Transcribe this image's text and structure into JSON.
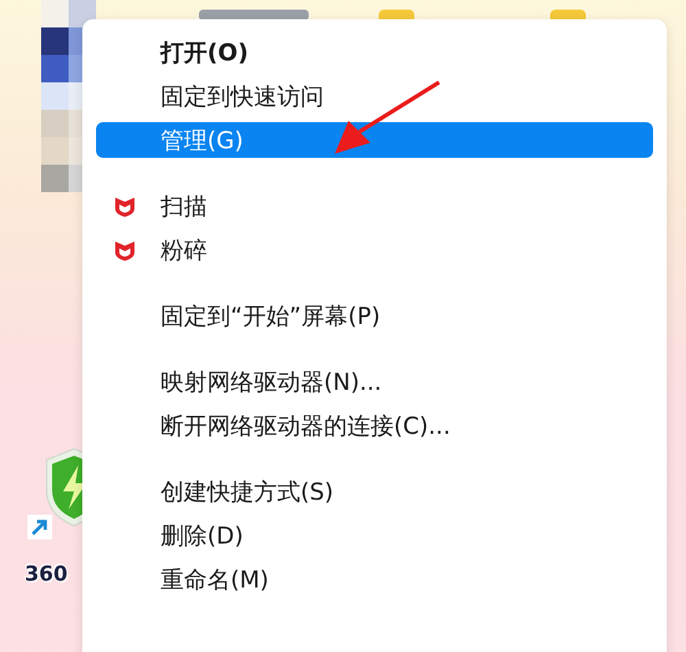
{
  "desktop_icons": [
    {
      "label": "360"
    }
  ],
  "context_menu": {
    "items": [
      {
        "kind": "item",
        "label": "打开(O)",
        "bold": true,
        "selected": false
      },
      {
        "kind": "item",
        "label": "固定到快速访问",
        "bold": false,
        "selected": false
      },
      {
        "kind": "item",
        "label": "管理(G)",
        "bold": false,
        "selected": true
      },
      {
        "kind": "separator"
      },
      {
        "kind": "shield_item",
        "label": "扫描",
        "bold": false,
        "selected": false
      },
      {
        "kind": "shield_item",
        "label": "粉碎",
        "bold": false,
        "selected": false
      },
      {
        "kind": "separator"
      },
      {
        "kind": "item",
        "label": "固定到“开始”屏幕(P)",
        "bold": false,
        "selected": false
      },
      {
        "kind": "separator"
      },
      {
        "kind": "item",
        "label": "映射网络驱动器(N)...",
        "bold": false,
        "selected": false
      },
      {
        "kind": "item",
        "label": "断开网络驱动器的连接(C)...",
        "bold": false,
        "selected": false
      },
      {
        "kind": "separator"
      },
      {
        "kind": "item",
        "label": "创建快捷方式(S)",
        "bold": false,
        "selected": false
      },
      {
        "kind": "item",
        "label": "删除(D)",
        "bold": false,
        "selected": false
      },
      {
        "kind": "item",
        "label": "重命名(M)",
        "bold": false,
        "selected": false
      }
    ]
  }
}
